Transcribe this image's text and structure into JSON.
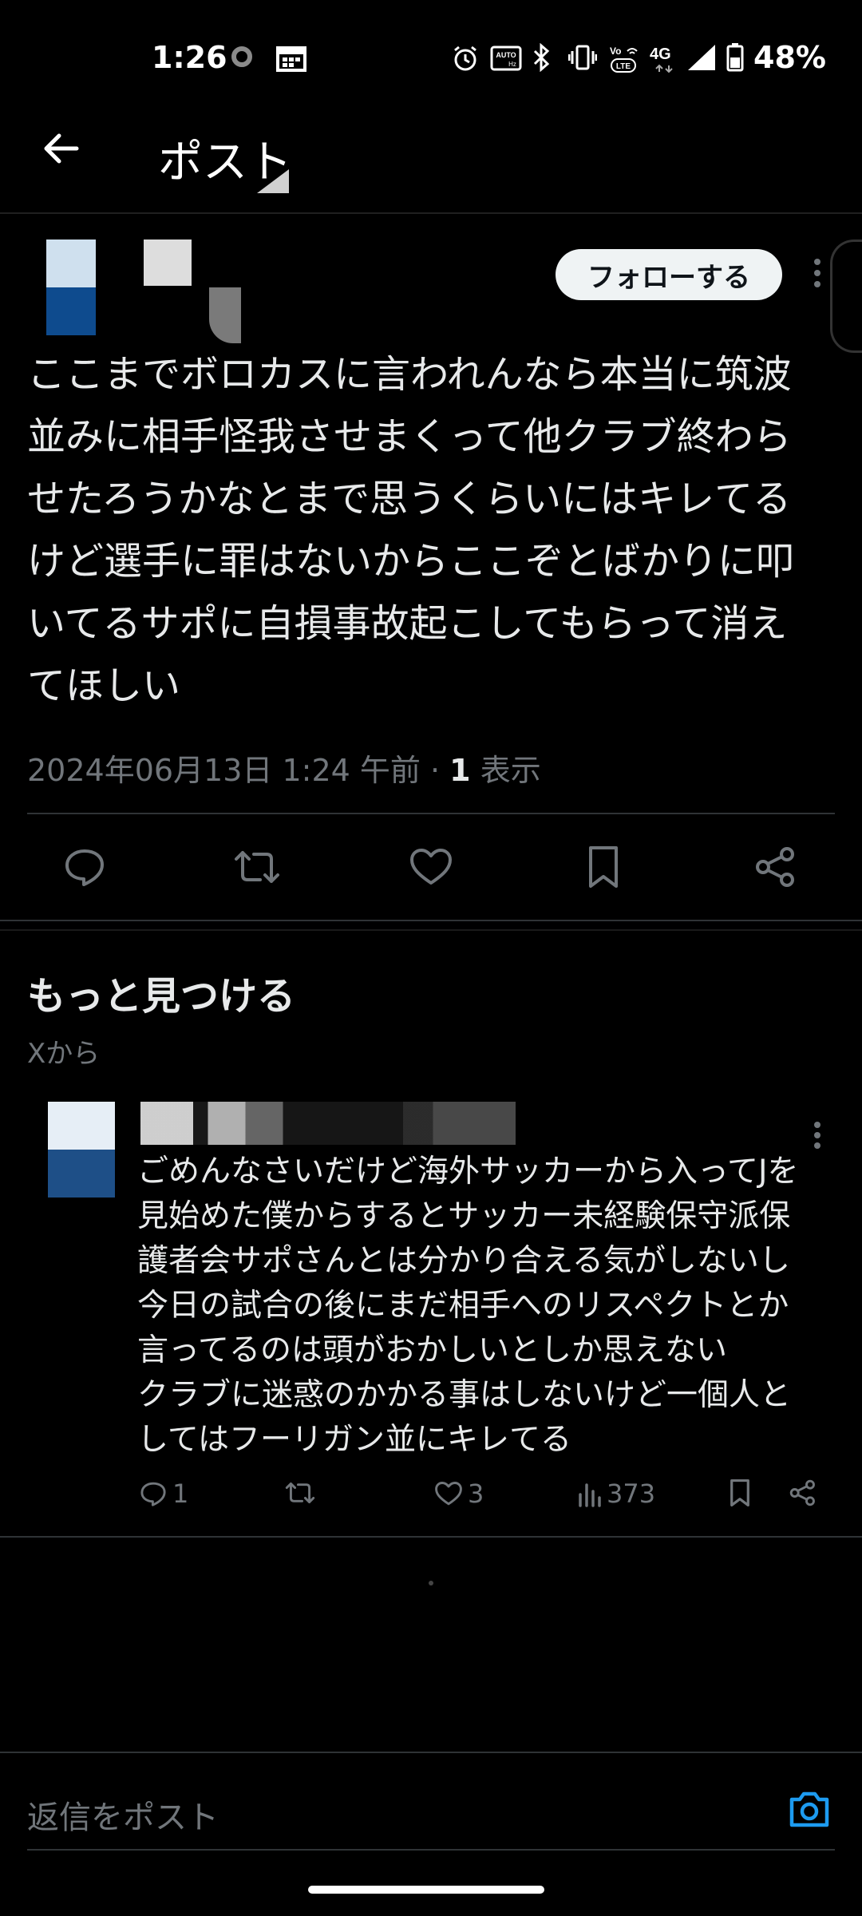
{
  "status_bar": {
    "time": "1:26",
    "battery": "48%",
    "network": "4G"
  },
  "header": {
    "title": "ポスト"
  },
  "post": {
    "follow_label": "フォローする",
    "text": "ここまでボロカスに言われんなら本当に筑波\n並みに相手怪我させまくって他クラブ終わら\nせたろうかなとまで思うくらいにはキレてる\nけど選手に罪はないからここぞとばかりに叩\nいてるサポに自損事故起こしてもらって消え\nてほしい",
    "timestamp": "2024年06月13日 1:24 午前 · ",
    "views_count": "1",
    "views_label": " 表示"
  },
  "discover": {
    "title": "もっと見つける",
    "subtitle": "Xから",
    "item": {
      "text": "ごめんなさいだけど海外サッカーから入ってJを\n見始めた僕からするとサッカー未経験保守派保\n護者会サポさんとは分かり合える気がしないし\n今日の試合の後にまだ相手へのリスペクトとか\n言ってるのは頭がおかしいとしか思えない\nクラブに迷惑のかかる事はしないけど一個人と\nしてはフーリガン並にキレてる",
      "reply_count": "1",
      "like_count": "3",
      "view_count": "373"
    }
  },
  "reply_bar": {
    "placeholder": "返信をポスト"
  },
  "colors": {
    "background": "#000000",
    "text": "#e7e9ea",
    "muted": "#71767b",
    "accent": "#1d9bf0"
  }
}
